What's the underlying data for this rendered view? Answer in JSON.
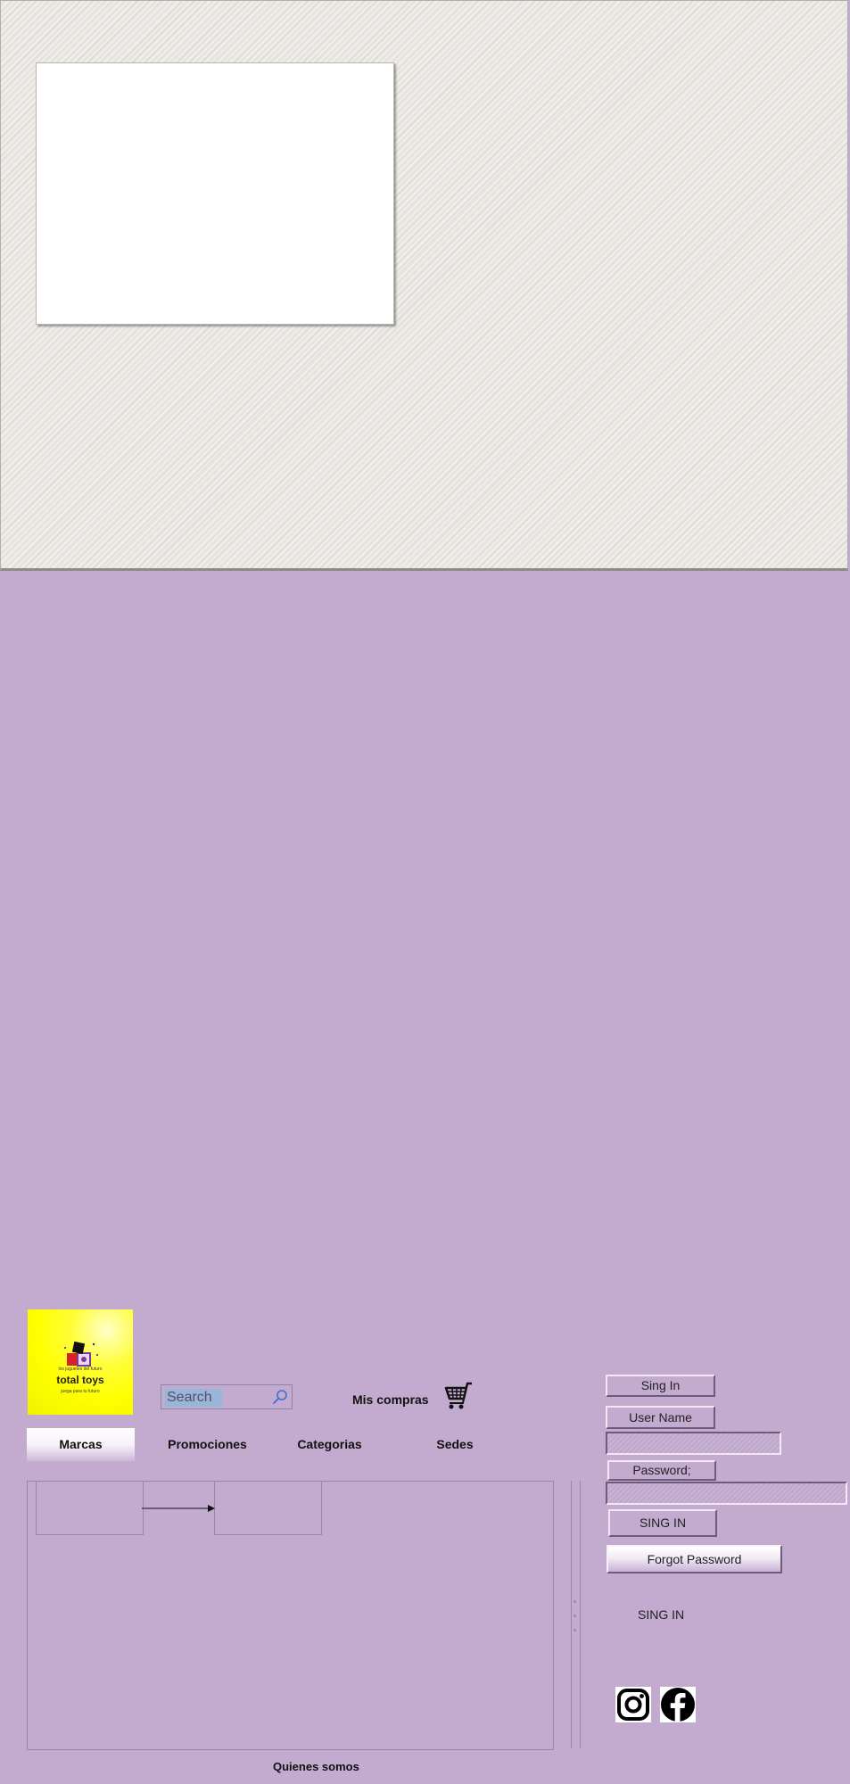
{
  "logo": {
    "tagline_top": "los juguetes del futuro",
    "brand": "total toys",
    "tagline_bottom": "juega para tu futuro"
  },
  "search": {
    "placeholder": "Search"
  },
  "header": {
    "purchases_label": "Mis compras"
  },
  "nav": {
    "tabs": [
      {
        "label": "Marcas"
      },
      {
        "label": "Promociones"
      },
      {
        "label": "Categorias"
      },
      {
        "label": "Sedes"
      }
    ]
  },
  "login": {
    "title": "Sing In",
    "username_label": "User Name",
    "password_label": "Password;",
    "submit_label": "SING IN",
    "forgot_label": "Forgot Password",
    "secondary_label": "SING IN"
  },
  "footer": {
    "about_label": "Quienes somos"
  },
  "social": {
    "icons": [
      "instagram-icon",
      "facebook-icon"
    ]
  },
  "colors": {
    "page_background": "#c3aacf",
    "logo_background": "#ffff00",
    "banner_background": "#e7e4df"
  }
}
